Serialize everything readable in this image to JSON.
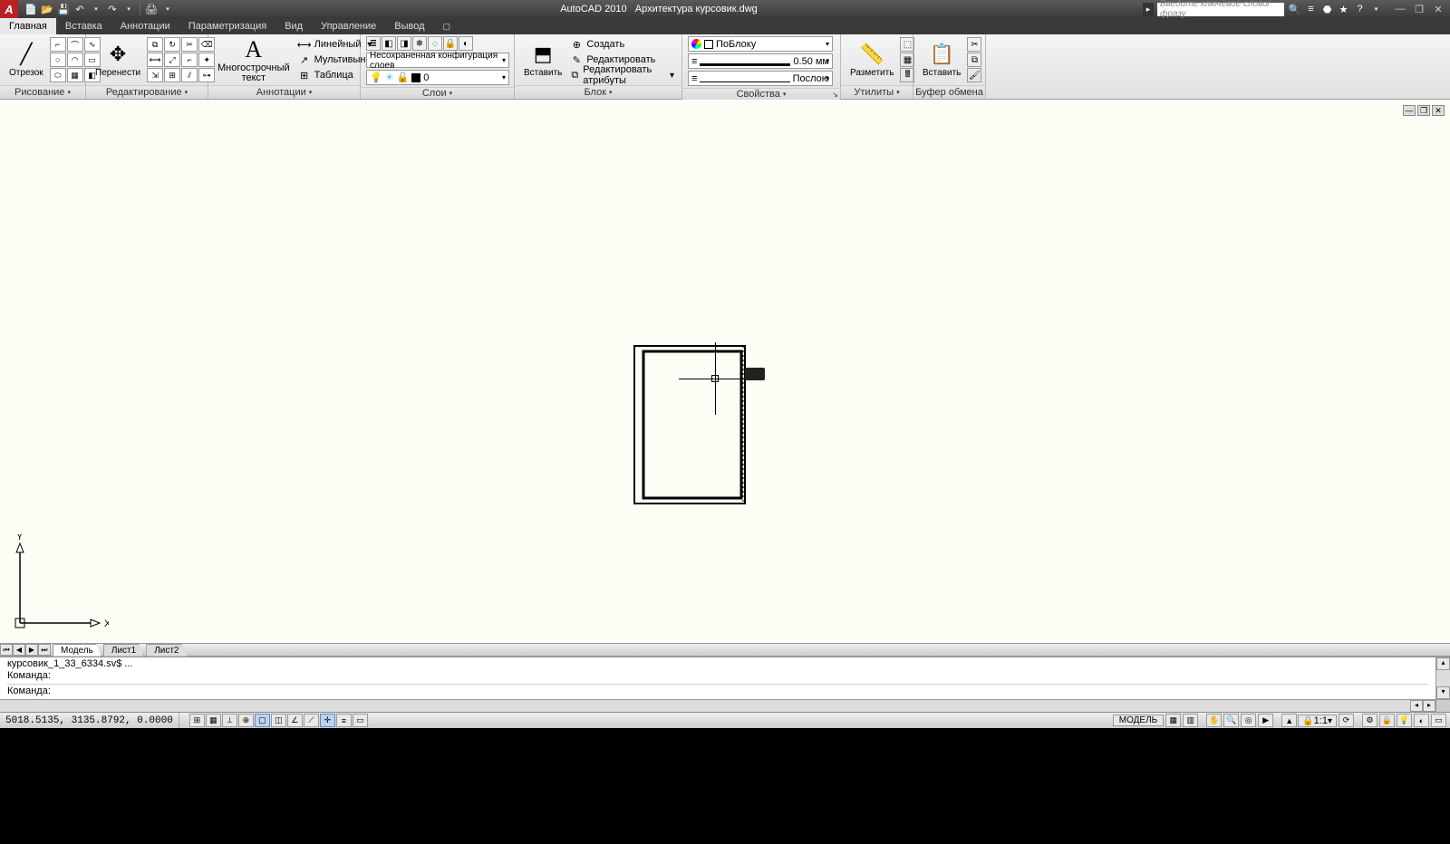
{
  "title": {
    "app": "AutoCAD 2010",
    "doc": "Архитектура курсовик.dwg"
  },
  "search_placeholder": "Введите ключевое слово/фразу",
  "tabs": [
    "Главная",
    "Вставка",
    "Аннотации",
    "Параметризация",
    "Вид",
    "Управление",
    "Вывод"
  ],
  "active_tab": 0,
  "panels": {
    "draw": {
      "title": "Рисование",
      "btn": "Отрезок"
    },
    "edit": {
      "title": "Редактирование",
      "btn": "Перенести"
    },
    "annot": {
      "title": "Аннотации",
      "btn1": "Многострочный",
      "btn2": "текст",
      "linear": "Линейный",
      "multi": "Мультивыноска",
      "table": "Таблица"
    },
    "layers": {
      "title": "Слои",
      "combo": "Несохраненная конфигурация слоев",
      "current": "0"
    },
    "block": {
      "title": "Блок",
      "insert": "Вставить",
      "create": "Создать",
      "editbtn": "Редактировать",
      "attrib": "Редактировать атрибуты"
    },
    "props": {
      "title": "Свойства",
      "bylayer": "ПоБлоку",
      "lw": "0.50 мм",
      "lt": "Послою"
    },
    "util": {
      "title": "Утилиты",
      "measure": "Разметить"
    },
    "clip": {
      "title": "Буфер обмена",
      "paste": "Вставить"
    }
  },
  "ucs": {
    "x": "X",
    "y": "Y"
  },
  "model_tabs": [
    "Модель",
    "Лист1",
    "Лист2"
  ],
  "cmd": {
    "line1": "курсовик_1_33_6334.sv$ ...",
    "line2": "Команда:",
    "line3": "Команда:"
  },
  "status": {
    "coords": "5018.5135, 3135.8792, 0.0000",
    "model": "МОДЕЛЬ",
    "scale": "1:1"
  }
}
